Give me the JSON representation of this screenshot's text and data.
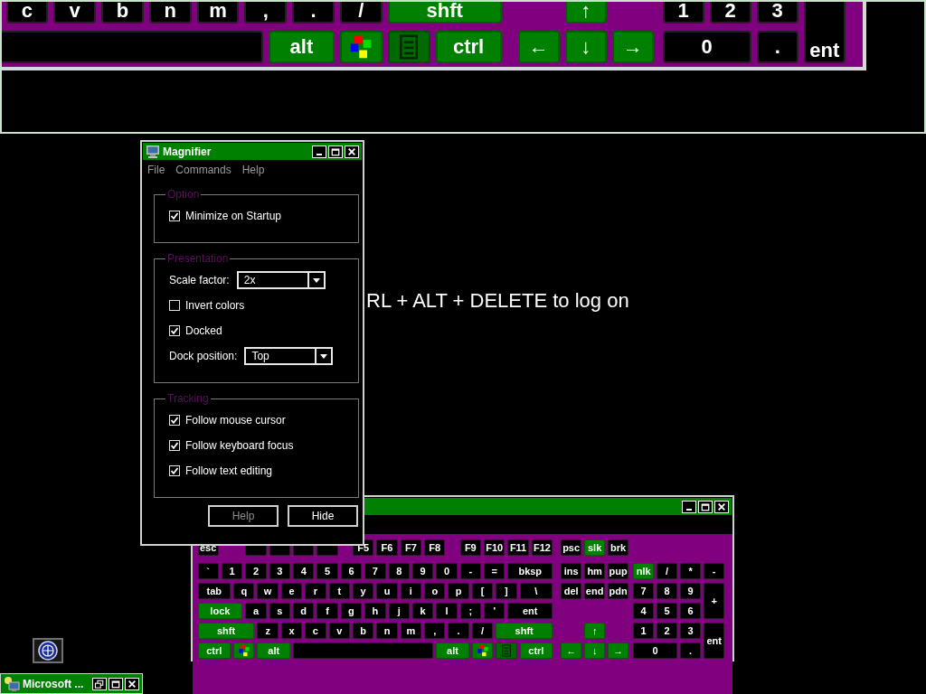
{
  "magnifier_view": {
    "rows": [
      {
        "keys": [
          {
            "kind": "key",
            "label": "c"
          },
          {
            "kind": "key",
            "label": "v"
          },
          {
            "kind": "key",
            "label": "b"
          },
          {
            "kind": "key",
            "label": "n"
          },
          {
            "kind": "key",
            "label": "m"
          },
          {
            "kind": "key",
            "label": ","
          },
          {
            "kind": "key",
            "label": "."
          },
          {
            "kind": "key",
            "label": "/"
          },
          {
            "kind": "mod",
            "label": "shft"
          },
          {
            "kind": "mod",
            "label": "↑"
          },
          {
            "kind": "key",
            "label": "1"
          },
          {
            "kind": "key",
            "label": "2"
          },
          {
            "kind": "key",
            "label": "3"
          },
          {
            "kind": "key",
            "label": "ent"
          }
        ]
      },
      {
        "keys": [
          {
            "kind": "space"
          },
          {
            "kind": "mod",
            "label": "alt"
          },
          {
            "kind": "logo"
          },
          {
            "kind": "menu"
          },
          {
            "kind": "mod",
            "label": "ctrl"
          },
          {
            "kind": "mod",
            "label": "←"
          },
          {
            "kind": "mod",
            "label": "↓"
          },
          {
            "kind": "mod",
            "label": "→"
          },
          {
            "kind": "key",
            "label": "0"
          },
          {
            "kind": "key",
            "label": "."
          }
        ]
      }
    ]
  },
  "desktop_message": "RL + ALT + DELETE to log on",
  "magnifier": {
    "title": "Magnifier",
    "menu": [
      "File",
      "Commands",
      "Help"
    ],
    "groups": [
      {
        "legend": "Option",
        "items": [
          {
            "kind": "checkbox",
            "label": "Minimize on Startup",
            "checked": true
          }
        ]
      },
      {
        "legend": "Presentation",
        "items": [
          {
            "kind": "select",
            "label": "Scale factor:",
            "value": "2x"
          },
          {
            "kind": "checkbox",
            "label": "Invert colors",
            "checked": false
          },
          {
            "kind": "checkbox",
            "label": "Docked",
            "checked": true
          },
          {
            "kind": "select",
            "label": "Dock position:",
            "value": "Top"
          }
        ]
      },
      {
        "legend": "Tracking",
        "items": [
          {
            "kind": "checkbox",
            "label": "Follow mouse cursor",
            "checked": true
          },
          {
            "kind": "checkbox",
            "label": "Follow keyboard focus",
            "checked": true
          },
          {
            "kind": "checkbox",
            "label": "Follow text editing",
            "checked": true
          }
        ]
      }
    ],
    "buttons": [
      {
        "label": "Help",
        "disabled": true
      },
      {
        "label": "Hide",
        "disabled": false
      }
    ]
  },
  "keyboard_window": {
    "rows": [
      {
        "keys": [
          {
            "kind": "key",
            "label": "esc"
          },
          {
            "kind": "key"
          },
          {
            "kind": "key"
          },
          {
            "kind": "key"
          },
          {
            "kind": "key"
          },
          {
            "kind": "key",
            "label": "F5"
          },
          {
            "kind": "key",
            "label": "F6"
          },
          {
            "kind": "key",
            "label": "F7"
          },
          {
            "kind": "key",
            "label": "F8"
          },
          {
            "kind": "key",
            "label": "F9"
          },
          {
            "kind": "key",
            "label": "F10"
          },
          {
            "kind": "key",
            "label": "F11"
          },
          {
            "kind": "key",
            "label": "F12"
          },
          {
            "kind": "key",
            "label": "psc"
          },
          {
            "kind": "mod",
            "label": "slk"
          },
          {
            "kind": "key",
            "label": "brk"
          }
        ]
      },
      {
        "keys": [
          {
            "kind": "key",
            "label": "`"
          },
          {
            "kind": "key",
            "label": "1"
          },
          {
            "kind": "key",
            "label": "2"
          },
          {
            "kind": "key",
            "label": "3"
          },
          {
            "kind": "key",
            "label": "4"
          },
          {
            "kind": "key",
            "label": "5"
          },
          {
            "kind": "key",
            "label": "6"
          },
          {
            "kind": "key",
            "label": "7"
          },
          {
            "kind": "key",
            "label": "8"
          },
          {
            "kind": "key",
            "label": "9"
          },
          {
            "kind": "key",
            "label": "0"
          },
          {
            "kind": "key",
            "label": "-"
          },
          {
            "kind": "key",
            "label": "="
          },
          {
            "kind": "key",
            "label": "bksp"
          },
          {
            "kind": "key",
            "label": "ins"
          },
          {
            "kind": "key",
            "label": "hm"
          },
          {
            "kind": "key",
            "label": "pup"
          },
          {
            "kind": "mod",
            "label": "nlk"
          },
          {
            "kind": "key",
            "label": "/"
          },
          {
            "kind": "key",
            "label": "*"
          },
          {
            "kind": "key",
            "label": "-"
          }
        ]
      },
      {
        "keys": [
          {
            "kind": "key",
            "label": "tab"
          },
          {
            "kind": "key",
            "label": "q"
          },
          {
            "kind": "key",
            "label": "w"
          },
          {
            "kind": "key",
            "label": "e"
          },
          {
            "kind": "key",
            "label": "r"
          },
          {
            "kind": "key",
            "label": "t"
          },
          {
            "kind": "key",
            "label": "y"
          },
          {
            "kind": "key",
            "label": "u"
          },
          {
            "kind": "key",
            "label": "i"
          },
          {
            "kind": "key",
            "label": "o"
          },
          {
            "kind": "key",
            "label": "p"
          },
          {
            "kind": "key",
            "label": "["
          },
          {
            "kind": "key",
            "label": "]"
          },
          {
            "kind": "key",
            "label": "\\"
          },
          {
            "kind": "key",
            "label": "del"
          },
          {
            "kind": "key",
            "label": "end"
          },
          {
            "kind": "key",
            "label": "pdn"
          },
          {
            "kind": "key",
            "label": "7"
          },
          {
            "kind": "key",
            "label": "8"
          },
          {
            "kind": "key",
            "label": "9"
          },
          {
            "kind": "key",
            "label": "+"
          }
        ]
      },
      {
        "keys": [
          {
            "kind": "mod",
            "label": "lock"
          },
          {
            "kind": "key",
            "label": "a"
          },
          {
            "kind": "key",
            "label": "s"
          },
          {
            "kind": "key",
            "label": "d"
          },
          {
            "kind": "key",
            "label": "f"
          },
          {
            "kind": "key",
            "label": "g"
          },
          {
            "kind": "key",
            "label": "h"
          },
          {
            "kind": "key",
            "label": "j"
          },
          {
            "kind": "key",
            "label": "k"
          },
          {
            "kind": "key",
            "label": "l"
          },
          {
            "kind": "key",
            "label": ";"
          },
          {
            "kind": "key",
            "label": "'"
          },
          {
            "kind": "key",
            "label": "ent"
          },
          {
            "kind": "key",
            "label": "4"
          },
          {
            "kind": "key",
            "label": "5"
          },
          {
            "kind": "key",
            "label": "6"
          }
        ]
      },
      {
        "keys": [
          {
            "kind": "mod",
            "label": "shft"
          },
          {
            "kind": "key",
            "label": "z"
          },
          {
            "kind": "key",
            "label": "x"
          },
          {
            "kind": "key",
            "label": "c"
          },
          {
            "kind": "key",
            "label": "v"
          },
          {
            "kind": "key",
            "label": "b"
          },
          {
            "kind": "key",
            "label": "n"
          },
          {
            "kind": "key",
            "label": "m"
          },
          {
            "kind": "key",
            "label": ","
          },
          {
            "kind": "key",
            "label": "."
          },
          {
            "kind": "key",
            "label": "/"
          },
          {
            "kind": "mod",
            "label": "shft"
          },
          {
            "kind": "mod",
            "label": "↑"
          },
          {
            "kind": "key",
            "label": "1"
          },
          {
            "kind": "key",
            "label": "2"
          },
          {
            "kind": "key",
            "label": "3"
          },
          {
            "kind": "key",
            "label": "ent"
          }
        ]
      },
      {
        "keys": [
          {
            "kind": "mod",
            "label": "ctrl"
          },
          {
            "kind": "logo"
          },
          {
            "kind": "mod",
            "label": "alt"
          },
          {
            "kind": "space"
          },
          {
            "kind": "mod",
            "label": "alt"
          },
          {
            "kind": "logo"
          },
          {
            "kind": "menu"
          },
          {
            "kind": "mod",
            "label": "ctrl"
          },
          {
            "kind": "mod",
            "label": "←"
          },
          {
            "kind": "mod",
            "label": "↓"
          },
          {
            "kind": "mod",
            "label": "→"
          },
          {
            "kind": "key",
            "label": "0"
          },
          {
            "kind": "key",
            "label": "."
          }
        ]
      }
    ]
  },
  "minimized_window": {
    "title": "Microsoft ..."
  }
}
